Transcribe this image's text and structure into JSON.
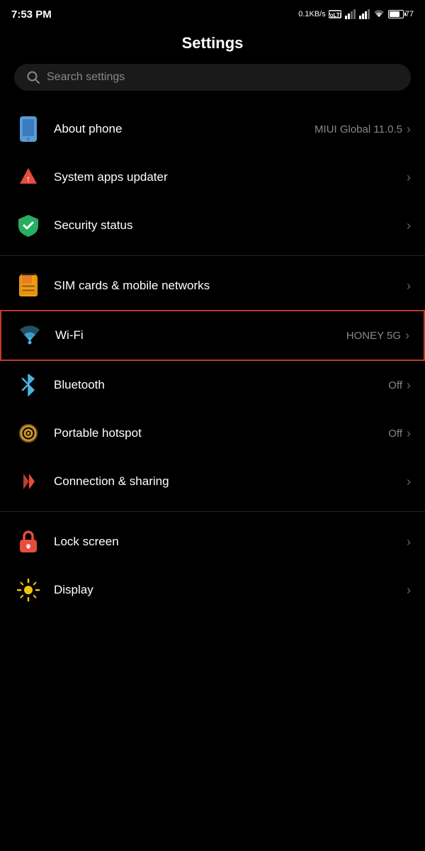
{
  "statusBar": {
    "time": "7:53 PM",
    "network": "0.1KB/s",
    "battery": "77"
  },
  "page": {
    "title": "Settings"
  },
  "search": {
    "placeholder": "Search settings"
  },
  "sections": [
    {
      "id": "system",
      "items": [
        {
          "id": "about-phone",
          "label": "About phone",
          "valueText": "MIUI Global 11.0.5",
          "icon": "phone-icon"
        },
        {
          "id": "system-apps-updater",
          "label": "System apps updater",
          "valueText": "",
          "icon": "update-icon"
        },
        {
          "id": "security-status",
          "label": "Security status",
          "valueText": "",
          "icon": "shield-icon"
        }
      ]
    },
    {
      "id": "network",
      "items": [
        {
          "id": "sim-cards",
          "label": "SIM cards & mobile networks",
          "valueText": "",
          "icon": "sim-icon"
        },
        {
          "id": "wifi",
          "label": "Wi-Fi",
          "valueText": "HONEY 5G",
          "icon": "wifi-icon",
          "highlighted": true
        },
        {
          "id": "bluetooth",
          "label": "Bluetooth",
          "valueText": "Off",
          "icon": "bluetooth-icon"
        },
        {
          "id": "hotspot",
          "label": "Portable hotspot",
          "valueText": "Off",
          "icon": "hotspot-icon"
        },
        {
          "id": "connection-sharing",
          "label": "Connection & sharing",
          "valueText": "",
          "icon": "connection-icon"
        }
      ]
    },
    {
      "id": "display",
      "items": [
        {
          "id": "lock-screen",
          "label": "Lock screen",
          "valueText": "",
          "icon": "lock-icon"
        },
        {
          "id": "display",
          "label": "Display",
          "valueText": "",
          "icon": "display-icon"
        }
      ]
    }
  ]
}
